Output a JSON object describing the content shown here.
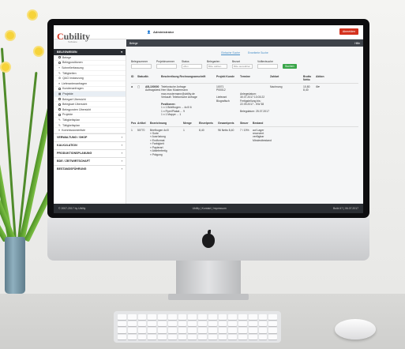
{
  "app": {
    "logo_c": "C",
    "logo_rest": "ubility",
    "logo_sub": "Software",
    "user": "Administrator",
    "logout": "Abmelden"
  },
  "sidebar": {
    "section1": "BELEGWESEN",
    "items": [
      "Belege",
      "Belegpositionen",
      "Schnellerfassung",
      "Tätigkeiten",
      "QAG Instanzung",
      "Lieferantenanfragen",
      "Kundenanfragen",
      "Projekte",
      "Belegart Übersicht",
      "Belegkart Übersicht",
      "Belegposten Übersicht",
      "Projekte",
      "Tätigkeitsplan",
      "Tätigkeitsplan",
      "Kommissionierliste"
    ],
    "sections": [
      "VERWALTUNG / SHOP",
      "KALKULATION",
      "PRODUKTIONSPLANUNG",
      "BDE / ZEITWIRTSCHAFT",
      "BESTANDSFÜHRUNG"
    ]
  },
  "main": {
    "crumb": "Belege",
    "crumb_right": "Hilfe",
    "tabs": [
      "Einfache Suche",
      "Erweiterte Suche"
    ],
    "filters": [
      {
        "label": "Belegnummer",
        "value": ""
      },
      {
        "label": "Projektnummer",
        "value": ""
      },
      {
        "label": "Status",
        "value": "offen"
      },
      {
        "label": "Belegarten",
        "value": "Bitte wählen"
      },
      {
        "label": "Bezart",
        "value": "Bitte auswählen"
      },
      {
        "label": "Volltextsuche",
        "value": ""
      }
    ],
    "search_btn": "Suchen",
    "headers": [
      "ID",
      "Status",
      "Nr.",
      "Beschreibung Rechnungsanschrift",
      "Projekt Kunde",
      "Termine",
      "Zahlart",
      "Brutto Netto",
      "Aktion"
    ],
    "row": {
      "id": "AB-100000",
      "sub": "Auftragsbest.",
      "desc": [
        "Telefonische Anfrage",
        "Herr Max Mustermann",
        "max.mustermann@ubility.de",
        "Verkauft: Telefonische Anfrage",
        "Positionen:",
        "1 x 1 Briefbogen ... 4c/0 6",
        "1 x Flyer/Plakat ... 9",
        "1 x 1 Mappe ... 1"
      ],
      "projekt": [
        "10071",
        "P00012",
        "Lieferant Biografisch"
      ],
      "termine": [
        "Anlegedatum:",
        "30.07.2017 13:03:22",
        "Fertigstellung bis:",
        "22.09.2017 - KW 38",
        "Belegdatum: 25.07.2017"
      ],
      "zahlart": "Nachnung",
      "brutto": "10,80",
      "netto": "8,40"
    },
    "pos_headers": [
      "Pos",
      "Artikel",
      "Bezeichnung",
      "Menge",
      "Einzelpreis",
      "Gesamtpreis",
      "Steuer",
      "Bestand"
    ],
    "pos_row": {
      "pos": "1",
      "artikel": "50770",
      "bez": [
        "Briefbogen 4c/0",
        "» Sorte",
        "» Ausrüstung",
        "» Endformat",
        "» Farbigkeit",
        "» Papierart",
        "» Ablieferfertig",
        "» Prägung"
      ],
      "menge": "1",
      "einzel": "8,40",
      "gesamt": "96 Netto 8,40",
      "steuer": "7 / 19%",
      "bestand": [
        "auf Lager",
        "reserviert",
        "verfügbar",
        "Mindestbestand"
      ]
    }
  },
  "footer": {
    "left": "© 2007-2017 by Ubility",
    "center": "Ubility | Kontakt | Impressum",
    "right": "Build 47 | 06.07.2017"
  }
}
